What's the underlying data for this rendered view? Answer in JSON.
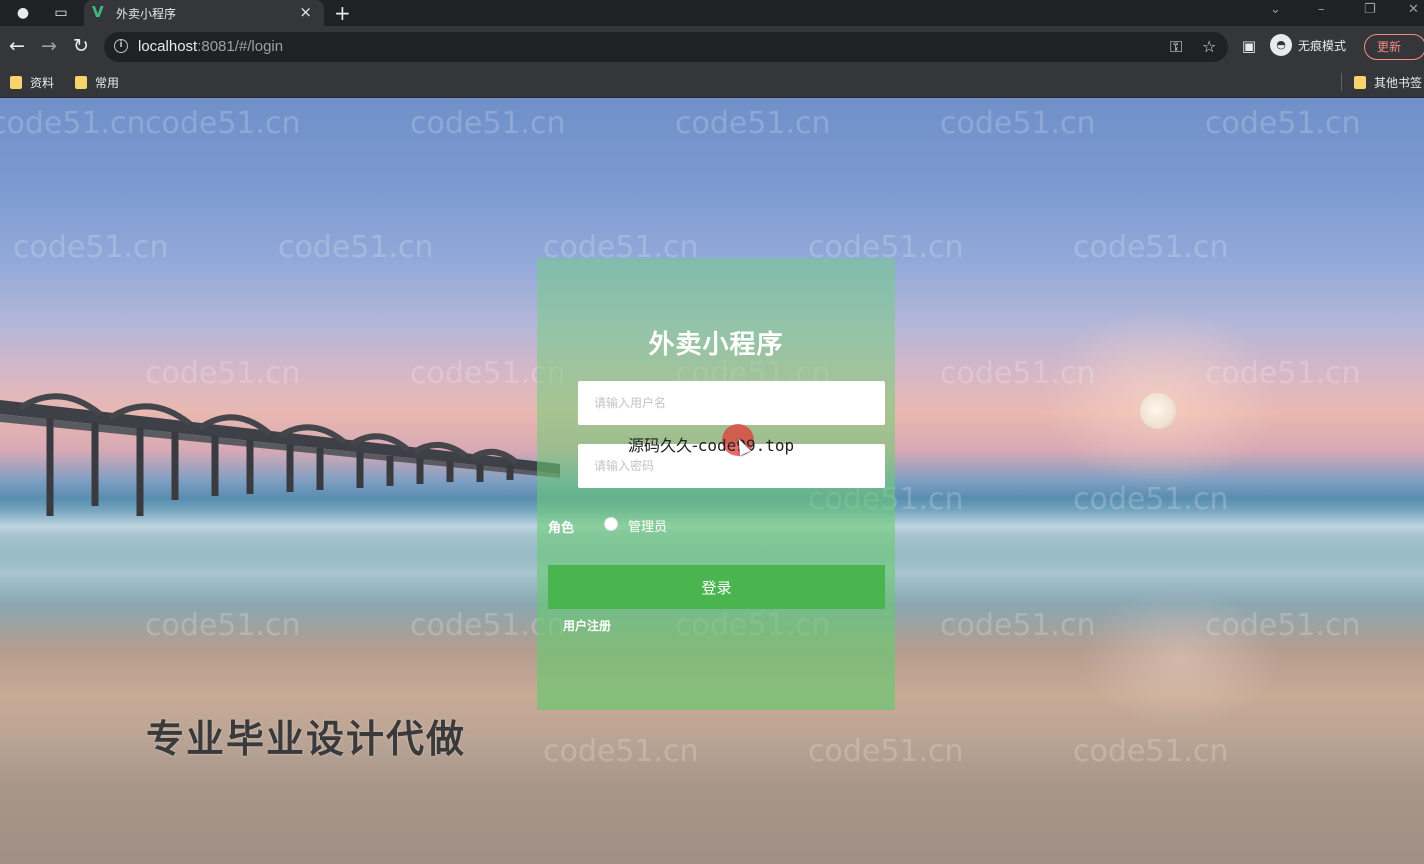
{
  "browser": {
    "tab_title": "外卖小程序",
    "url_host": "localhost",
    "url_rest": ":8081/#/login",
    "profile_label": "无痕模式",
    "update_label": "更新",
    "bookmarks": [
      "资料",
      "常用"
    ],
    "other_bookmarks": "其他书签"
  },
  "login": {
    "title": "外卖小程序",
    "username_placeholder": "请输入用户名",
    "password_placeholder": "请输入密码",
    "role_label": "角色",
    "role_option": "管理员",
    "login_button": "登录",
    "register_link": "用户注册"
  },
  "overlays": {
    "source_text_cn": "源码久久-",
    "source_text_domain": "code99.top",
    "promo_text": "专业毕业设计代做",
    "watermark": "code51.cn"
  }
}
